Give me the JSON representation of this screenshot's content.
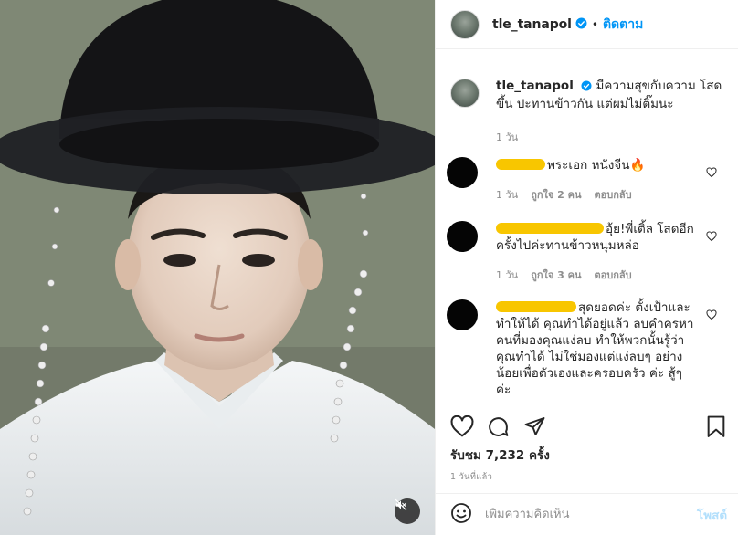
{
  "post": {
    "username": "tle_tanapol",
    "follow_label": "ติดตาม",
    "dot": "•"
  },
  "caption": {
    "username": "tle_tanapol",
    "text": "มีความสุขกับความ โสด ขึ้น ปะทานข้าวกัน แต่ผมไม่ติ๊มนะ",
    "time": "1 วัน"
  },
  "comments": [
    {
      "text": "พระเอก หนังจีน🔥",
      "time": "1 วัน",
      "likes": "ถูกใจ 2 คน",
      "reply": "ตอบกลับ"
    },
    {
      "text": "อุ้ย!พี่เติ้ล โสดอีกครั้งไปค่ะทานข้าวหนุ่มหล่อ",
      "time": "1 วัน",
      "likes": "ถูกใจ 3 คน",
      "reply": "ตอบกลับ"
    },
    {
      "text": "สุดยอดค่ะ ตั้งเป้าและทำให้ได้ คุณทำได้อยู่แล้ว ลบคำครหาคนที่มองคุณแง่ลบ ทำให้พวกนั้นรู้ว่าคุณทำได้ ไม่ใช่มองแต่แง่ลบๆ อย่างน้อยเพื่อตัวเองและครอบครัว ค่ะ สู้ๆ ค่ะ"
    }
  ],
  "actions": {
    "likes": "รับชม 7,232 ครั้ง",
    "date": "1 วันที่แล้ว"
  },
  "add_comment": {
    "placeholder": "เพิ่มความคิดเห็น",
    "post_label": "โพสต์"
  },
  "icons": {
    "verified": "verified-badge-icon",
    "heart": "heart-icon",
    "comment": "comment-icon",
    "share": "share-icon",
    "save": "bookmark-icon",
    "emoji": "emoji-icon",
    "mute": "mute-icon"
  },
  "colors": {
    "accent": "#0095f6",
    "redaction": "#f8c600",
    "post_disabled": "#b2dffc"
  }
}
